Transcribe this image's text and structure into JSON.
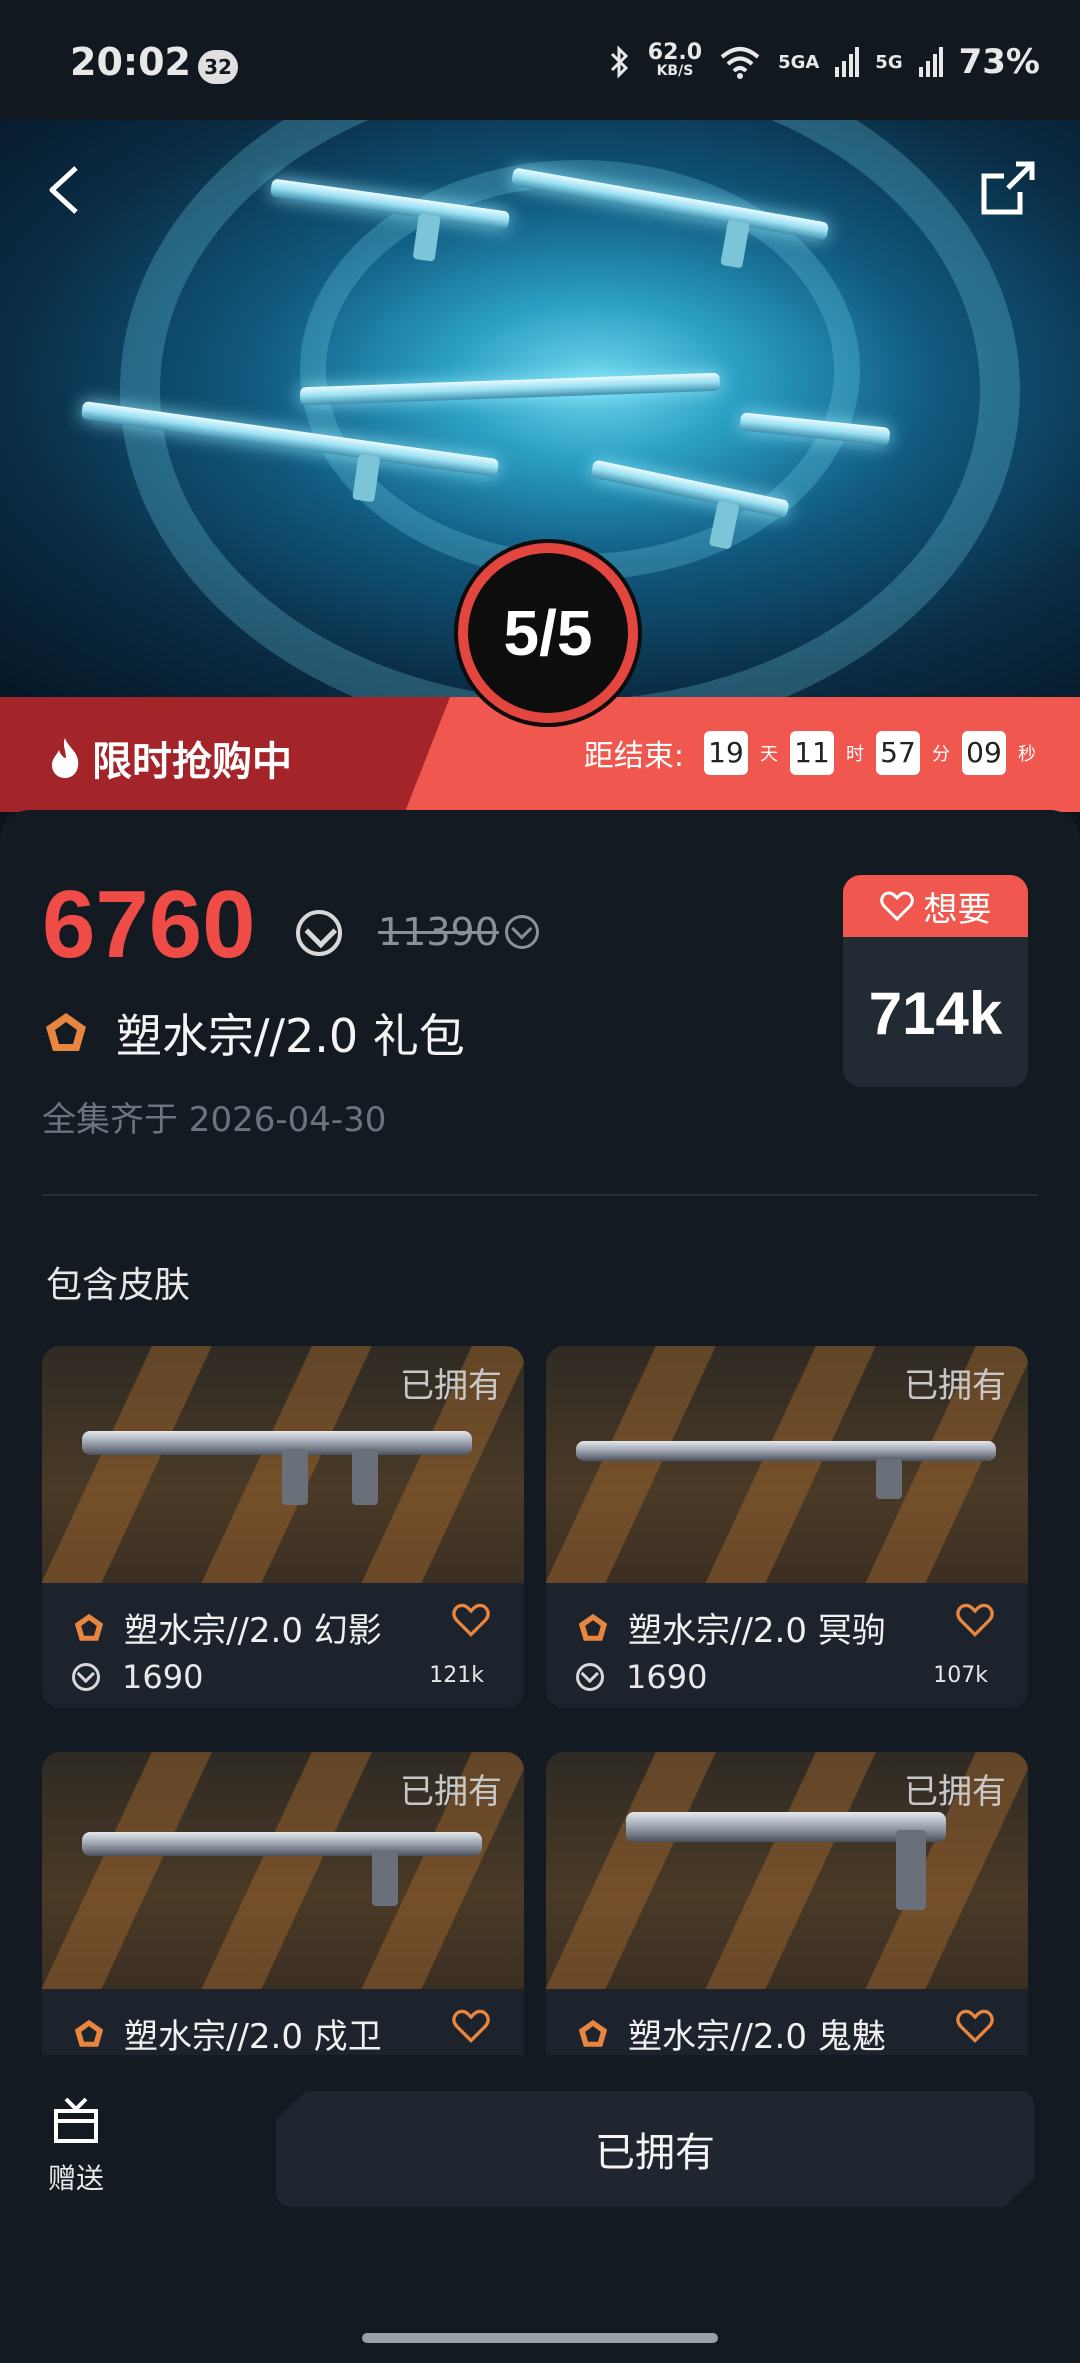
{
  "status_bar": {
    "time": "20:02",
    "notification_count": "32",
    "net_speed": "62.0",
    "net_speed_unit": "KB/S",
    "signal_1": "5GA",
    "signal_2": "5G",
    "battery": "73%"
  },
  "hero": {
    "progress": "5/5",
    "back_icon": "chevron-left-icon",
    "share_icon": "share-icon"
  },
  "flash_sale": {
    "title": "限时抢购中",
    "countdown_label": "距结束:",
    "days": "19",
    "days_unit": "天",
    "hours": "11",
    "hours_unit": "时",
    "minutes": "57",
    "minutes_unit": "分",
    "seconds": "09",
    "seconds_unit": "秒"
  },
  "bundle": {
    "price": "6760",
    "original_price": "11390",
    "name": "塑水宗//2.0 礼包",
    "complete_date": "全集齐于 2026-04-30",
    "want_label": "想要",
    "want_count": "714k"
  },
  "section_title": "包含皮肤",
  "skins": [
    {
      "owned": "已拥有",
      "name": "塑水宗//2.0 幻影",
      "price": "1690",
      "likes": "121k"
    },
    {
      "owned": "已拥有",
      "name": "塑水宗//2.0 冥驹",
      "price": "1690",
      "likes": "107k"
    },
    {
      "owned": "已拥有",
      "name": "塑水宗//2.0 戍卫"
    },
    {
      "owned": "已拥有",
      "name": "塑水宗//2.0 鬼魅"
    }
  ],
  "bottom": {
    "gift_label": "赠送",
    "action_label": "已拥有"
  },
  "colors": {
    "accent_red": "#f0584f",
    "dark_red": "#a3252a",
    "price_red": "#ef4c47",
    "tier_orange": "#e8853f",
    "background": "#131a22"
  }
}
